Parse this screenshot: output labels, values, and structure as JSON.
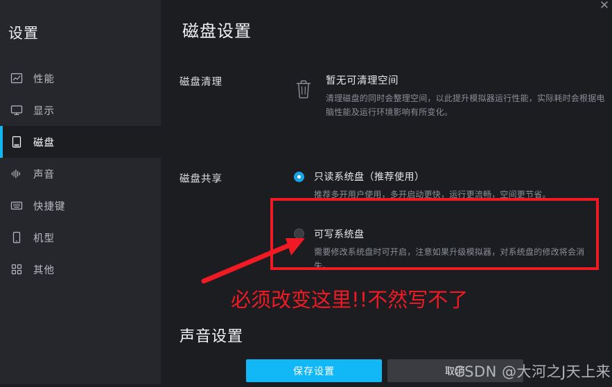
{
  "window": {
    "close_label": "✕"
  },
  "sidebar": {
    "title": "设置",
    "items": [
      {
        "label": "性能",
        "icon": "performance-chart-icon",
        "active": false
      },
      {
        "label": "显示",
        "icon": "monitor-icon",
        "active": false
      },
      {
        "label": "磁盘",
        "icon": "disk-icon",
        "active": true
      },
      {
        "label": "声音",
        "icon": "sound-wave-icon",
        "active": false
      },
      {
        "label": "快捷键",
        "icon": "keyboard-icon",
        "active": false
      },
      {
        "label": "机型",
        "icon": "phone-icon",
        "active": false
      },
      {
        "label": "其他",
        "icon": "grid-icon",
        "active": false
      }
    ]
  },
  "main": {
    "page_title": "磁盘设置",
    "disk_cleanup": {
      "label": "磁盘清理",
      "status_title": "暂无可清理空间",
      "description": "清理磁盘的同时会整理空间，以此提升模拟器运行性能，实际耗时会根据电脑性能及运行环境影响有所变化。",
      "icon": "trash-icon"
    },
    "disk_sharing": {
      "label": "磁盘共享",
      "options": [
        {
          "label": "只读系统盘（推荐使用）",
          "description": "推荐多开用户使用，多开启动更快，运行更流畅，空间更节省。",
          "selected": true
        },
        {
          "label": "可写系统盘",
          "description": "需要修改系统盘时可开启，注意如果升级模拟器，对系统盘的修改将会消失。",
          "selected": false
        }
      ]
    },
    "sound_settings_heading": "声音设置"
  },
  "footer": {
    "save_label": "保存设置",
    "cancel_label": "取消"
  },
  "annotation": {
    "text": "必须改变这里!!不然写不了",
    "color": "#ef1a23"
  },
  "watermark": {
    "text": "CSDN @大河之J天上来"
  },
  "colors": {
    "accent": "#12b7f5",
    "radio_selected": "#1aa3e8",
    "sidebar_bg": "#26272c",
    "content_bg": "#1c1d21",
    "annotation_red": "#ef1a23"
  }
}
